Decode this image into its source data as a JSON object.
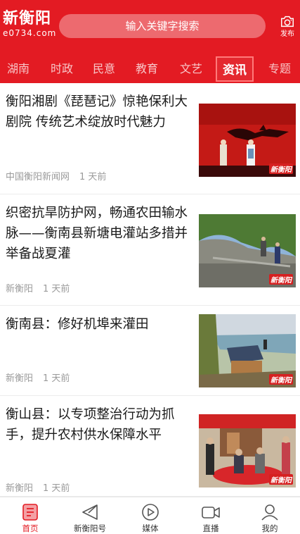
{
  "header": {
    "brand": "新衡阳",
    "domain": "e0734.com",
    "search_placeholder": "输入关键字搜索",
    "publish_label": "发布"
  },
  "tabs": [
    {
      "label": "湖南",
      "active": false
    },
    {
      "label": "时政",
      "active": false
    },
    {
      "label": "民意",
      "active": false
    },
    {
      "label": "教育",
      "active": false
    },
    {
      "label": "文艺",
      "active": false
    },
    {
      "label": "资讯",
      "active": true
    },
    {
      "label": "专题",
      "active": false
    }
  ],
  "feed": [
    {
      "title": "衡阳湘剧《琵琶记》惊艳保利大剧院 传统艺术绽放时代魅力",
      "source": "中国衡阳新闻网",
      "time": "1 天前",
      "image": "opera-stage-photo",
      "watermark": "新衡阳"
    },
    {
      "title": "织密抗旱防护网，畅通农田输水脉——衡南县新塘电灌站多措并举备战夏灌",
      "source": "新衡阳",
      "time": "1 天前",
      "image": "irrigation-canal-photo",
      "watermark": "新衡阳"
    },
    {
      "title": "衡南县：修好机埠来灌田",
      "source": "新衡阳",
      "time": "1 天前",
      "image": "pump-station-photo",
      "watermark": "新衡阳"
    },
    {
      "title": "衡山县：以专项整治行动为抓手，提升农村供水保障水平",
      "source": "新衡阳",
      "time": "1 天前",
      "image": "village-meeting-photo",
      "watermark": "新衡阳"
    }
  ],
  "bottom_nav": [
    {
      "label": "首页",
      "icon": "home-icon",
      "active": true
    },
    {
      "label": "新衡阳号",
      "icon": "send-icon",
      "active": false
    },
    {
      "label": "媒体",
      "icon": "play-icon",
      "active": false
    },
    {
      "label": "直播",
      "icon": "video-camera-icon",
      "active": false
    },
    {
      "label": "我的",
      "icon": "user-icon",
      "active": false
    }
  ],
  "colors": {
    "brand_red": "#e31b23",
    "active_tab_border": "#ff7a7a",
    "meta_gray": "#9a9a9a"
  }
}
